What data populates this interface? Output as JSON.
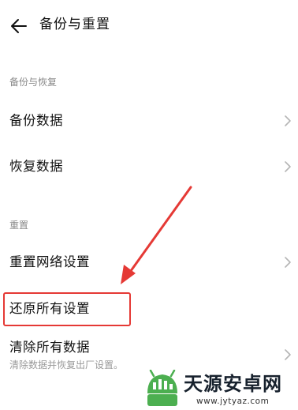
{
  "header": {
    "back_icon": "arrow-left-icon",
    "title": "备份与重置"
  },
  "sections": {
    "backup_restore": {
      "label": "备份与恢复",
      "items": [
        {
          "title": "备份数据",
          "icon": "chevron-right-icon"
        },
        {
          "title": "恢复数据",
          "icon": "chevron-right-icon"
        }
      ]
    },
    "reset": {
      "label": "重置",
      "items": [
        {
          "title": "重置网络设置",
          "icon": "chevron-right-icon"
        },
        {
          "title": "还原所有设置"
        },
        {
          "title": "清除所有数据",
          "subtitle": "清除数据并恢复出厂设置。",
          "icon": "chevron-right-icon"
        }
      ]
    }
  },
  "annotation": {
    "color": "#e53935"
  },
  "watermark": {
    "name": "天源安卓网",
    "url": "www.jytyaz.com",
    "logo_color": "#4caf50"
  }
}
